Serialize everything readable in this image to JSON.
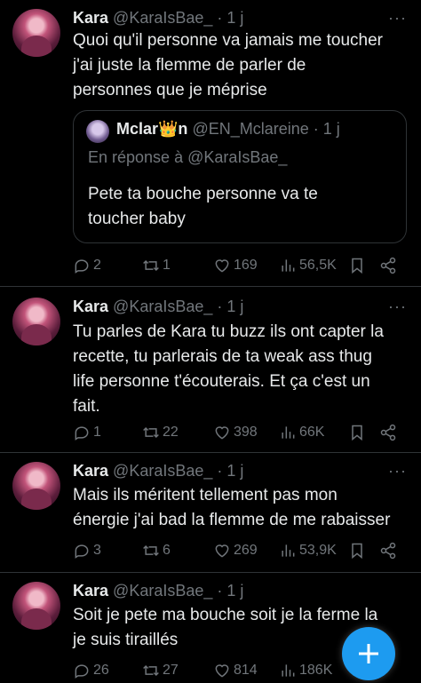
{
  "tweets": [
    {
      "name": "Kara",
      "handle": "@KaraIsBae_",
      "time": "· 1 j",
      "lines": [
        "Quoi qu'il personne va jamais me toucher",
        "j'ai juste la flemme de parler de",
        "personnes que je méprise"
      ],
      "quote": {
        "name": "Mclar👑n",
        "handle": "@EN_Mclareine · 1 j",
        "reply": "En réponse à @KaraIsBae_",
        "lines": [
          "Pete ta bouche personne va te",
          "toucher baby"
        ]
      },
      "replies": "2",
      "retweets": "1",
      "likes": "169",
      "views": "56,5K"
    },
    {
      "name": "Kara",
      "handle": "@KaraIsBae_",
      "time": "· 1 j",
      "lines": [
        "Tu parles de Kara tu buzz ils ont capter la",
        "recette, tu parlerais de ta weak ass thug",
        "life personne t'écouterais. Et ça c'est un",
        "fait."
      ],
      "replies": "1",
      "retweets": "22",
      "likes": "398",
      "views": "66K"
    },
    {
      "name": "Kara",
      "handle": "@KaraIsBae_",
      "time": "· 1 j",
      "lines": [
        "Mais ils méritent tellement pas mon",
        "énergie j'ai bad la flemme de me rabaisser"
      ],
      "replies": "3",
      "retweets": "6",
      "likes": "269",
      "views": "53,9K"
    },
    {
      "name": "Kara",
      "handle": "@KaraIsBae_",
      "time": "· 1 j",
      "lines": [
        "Soit je pete ma bouche soit je la ferme la",
        "je suis tiraillés"
      ],
      "replies": "26",
      "retweets": "27",
      "likes": "814",
      "views": "186K"
    }
  ],
  "icons": {
    "reply": "reply-icon",
    "retweet": "retweet-icon",
    "like": "heart-icon",
    "views": "views-icon",
    "bookmark": "bookmark-icon",
    "share": "share-icon",
    "more": "more-icon",
    "compose": "plus-icon"
  },
  "colors": {
    "background": "#000000",
    "text": "#e7e9ea",
    "muted": "#71767b",
    "accent": "#1d9bf0"
  }
}
